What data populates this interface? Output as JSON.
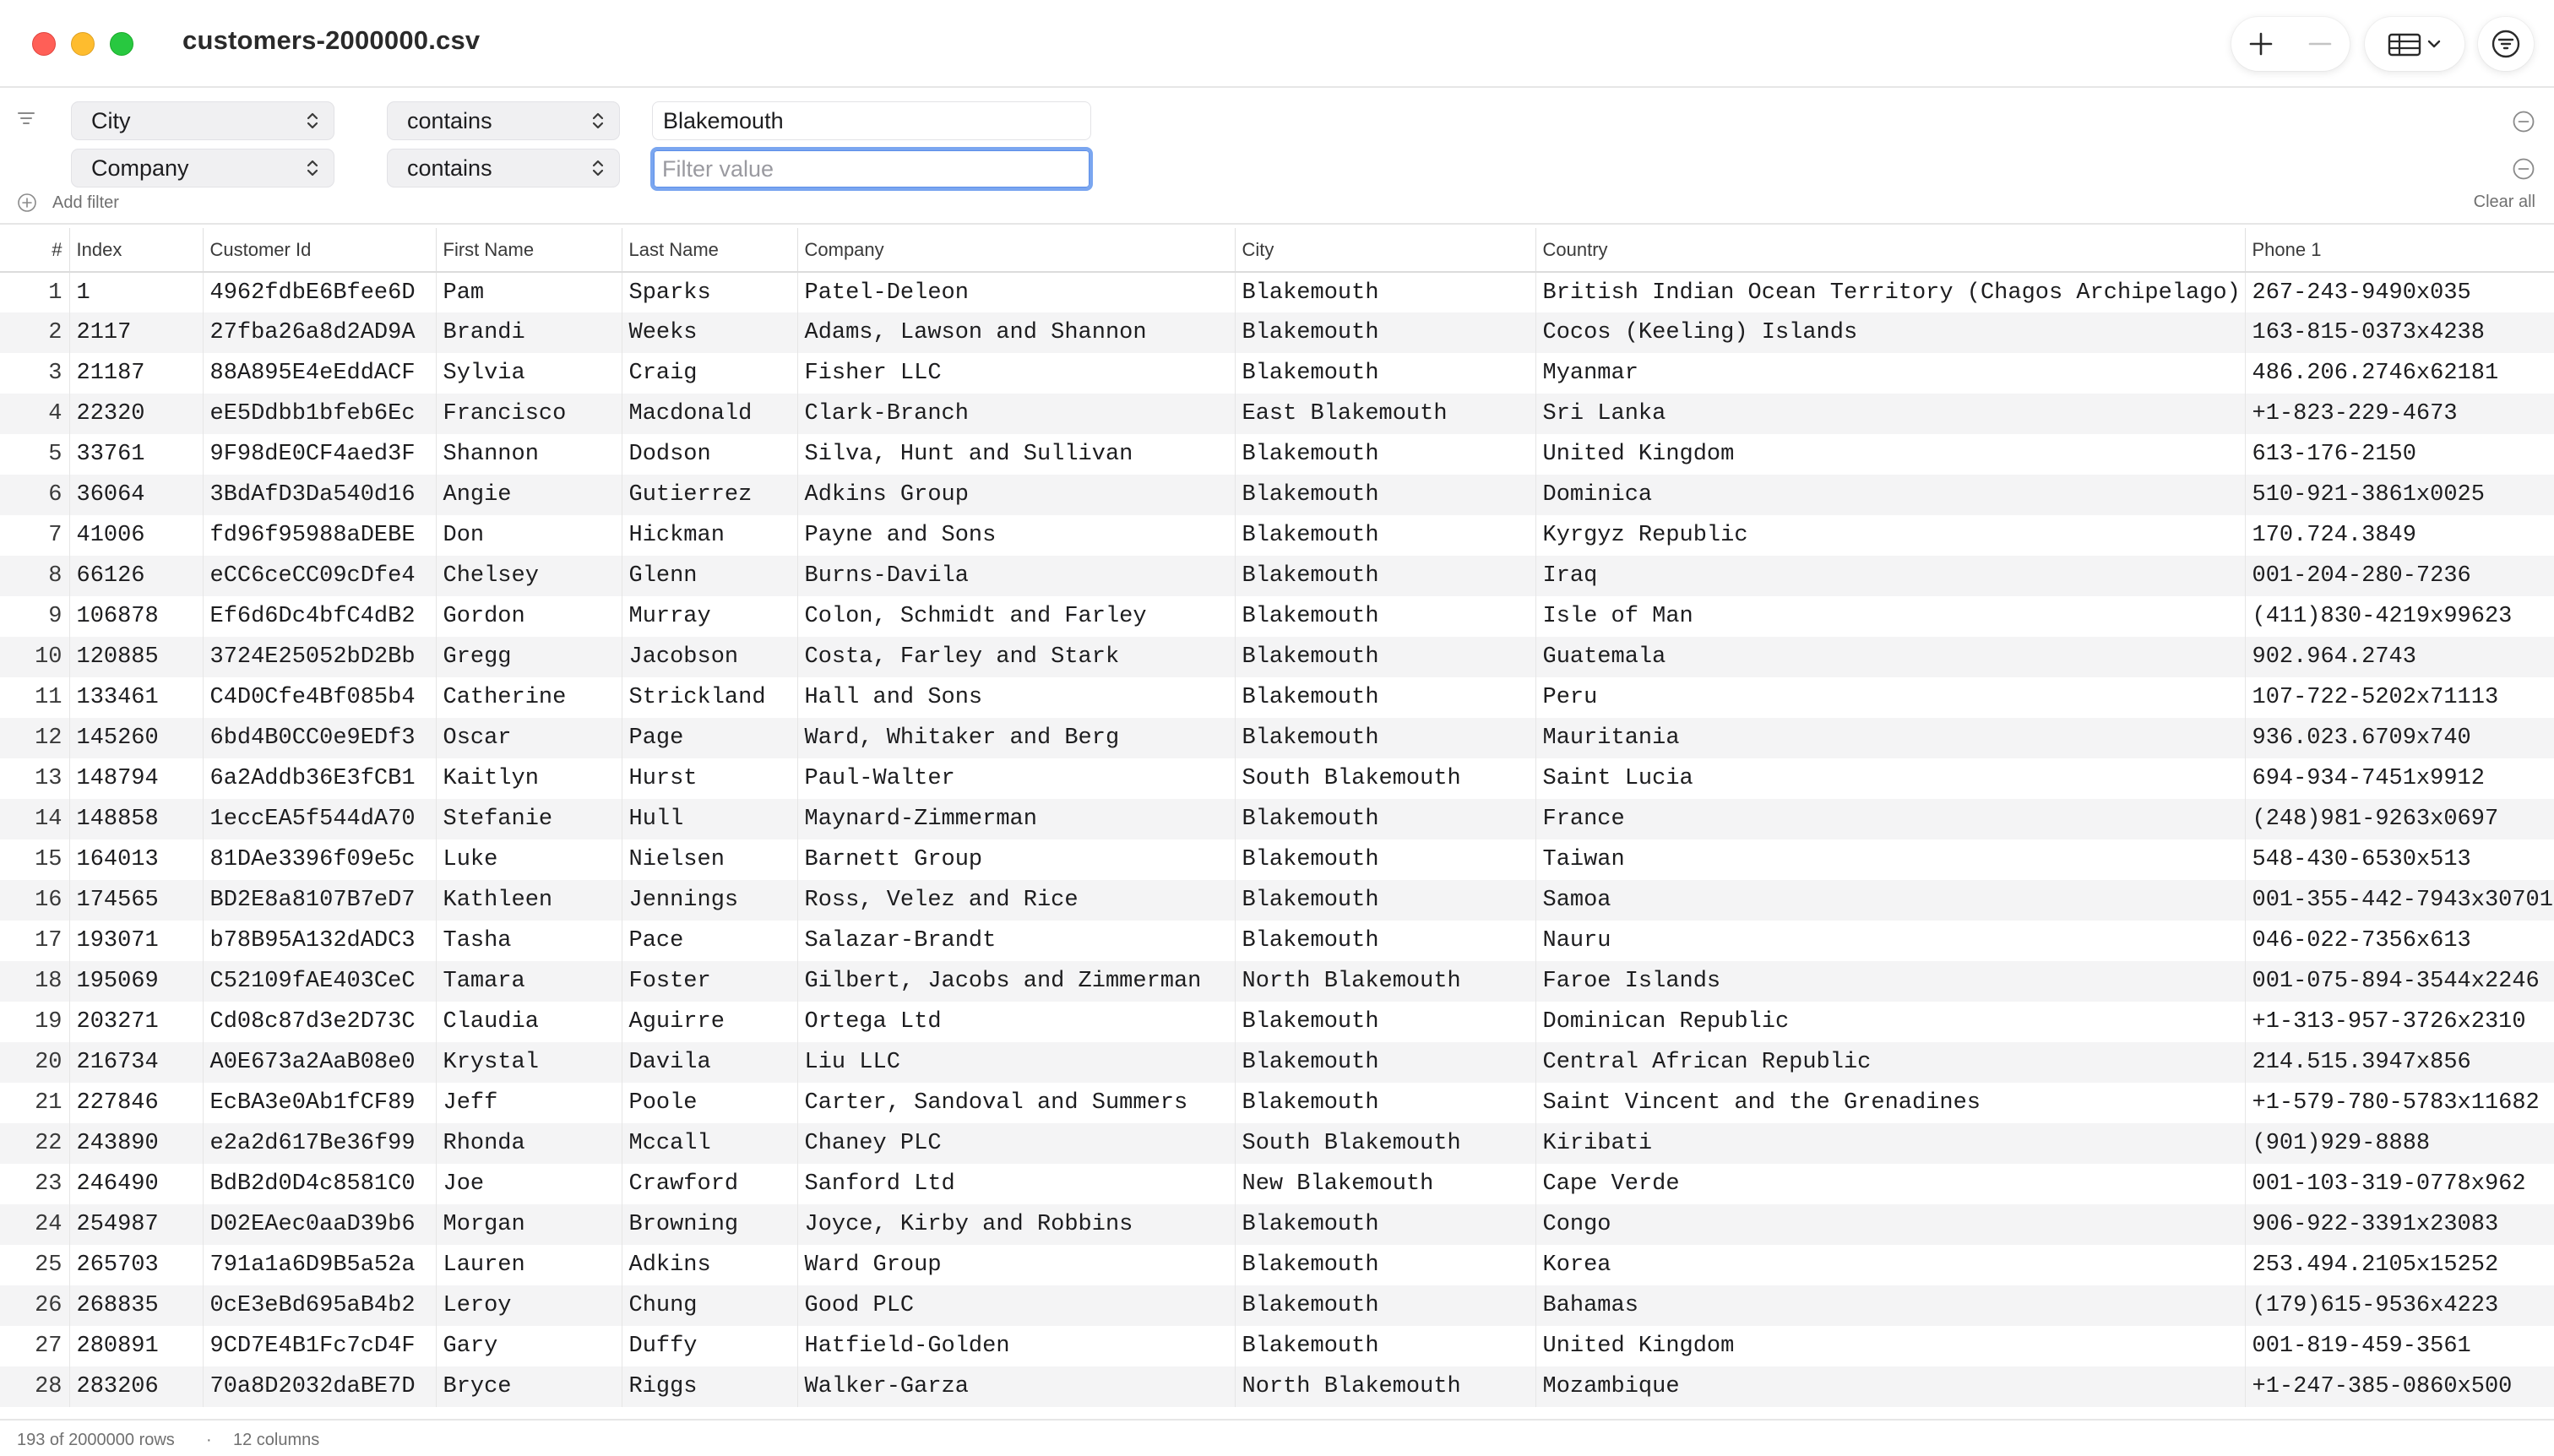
{
  "window": {
    "title": "customers-2000000.csv",
    "traffic_colors": {
      "close": "#ff5f57",
      "minimize": "#febc2e",
      "maximize": "#28c840"
    }
  },
  "toolbar": {
    "icons": [
      "plus-icon",
      "minus-icon",
      "table-view-icon",
      "chevron-down-icon",
      "filter-icon"
    ]
  },
  "filters": {
    "rows": [
      {
        "field": "City",
        "operator": "contains",
        "value": "Blakemouth",
        "placeholder": "Filter value"
      },
      {
        "field": "Company",
        "operator": "contains",
        "value": "",
        "placeholder": "Filter value"
      }
    ],
    "add_filter_label": "Add filter",
    "clear_all_label": "Clear all",
    "focus_color": "#7aa6f0"
  },
  "table": {
    "columns": [
      "#",
      "Index",
      "Customer Id",
      "First Name",
      "Last Name",
      "Company",
      "City",
      "Country",
      "Phone 1"
    ],
    "rows": [
      [
        "1",
        "1",
        "4962fdbE6Bfee6D",
        "Pam",
        "Sparks",
        "Patel-Deleon",
        "Blakemouth",
        "British Indian Ocean Territory (Chagos Archipelago)",
        "267-243-9490x035"
      ],
      [
        "2",
        "2117",
        "27fba26a8d2AD9A",
        "Brandi",
        "Weeks",
        "Adams, Lawson and Shannon",
        "Blakemouth",
        "Cocos (Keeling) Islands",
        "163-815-0373x4238"
      ],
      [
        "3",
        "21187",
        "88A895E4eEddACF",
        "Sylvia",
        "Craig",
        "Fisher LLC",
        "Blakemouth",
        "Myanmar",
        "486.206.2746x62181"
      ],
      [
        "4",
        "22320",
        "eE5Ddbb1bfeb6Ec",
        "Francisco",
        "Macdonald",
        "Clark-Branch",
        "East Blakemouth",
        "Sri Lanka",
        "+1-823-229-4673"
      ],
      [
        "5",
        "33761",
        "9F98dE0CF4aed3F",
        "Shannon",
        "Dodson",
        "Silva, Hunt and Sullivan",
        "Blakemouth",
        "United Kingdom",
        "613-176-2150"
      ],
      [
        "6",
        "36064",
        "3BdAfD3Da540d16",
        "Angie",
        "Gutierrez",
        "Adkins Group",
        "Blakemouth",
        "Dominica",
        "510-921-3861x0025"
      ],
      [
        "7",
        "41006",
        "fd96f95988aDEBE",
        "Don",
        "Hickman",
        "Payne and Sons",
        "Blakemouth",
        "Kyrgyz Republic",
        "170.724.3849"
      ],
      [
        "8",
        "66126",
        "eCC6ceCC09cDfe4",
        "Chelsey",
        "Glenn",
        "Burns-Davila",
        "Blakemouth",
        "Iraq",
        "001-204-280-7236"
      ],
      [
        "9",
        "106878",
        "Ef6d6Dc4bfC4dB2",
        "Gordon",
        "Murray",
        "Colon, Schmidt and Farley",
        "Blakemouth",
        "Isle of Man",
        "(411)830-4219x99623"
      ],
      [
        "10",
        "120885",
        "3724E25052bD2Bb",
        "Gregg",
        "Jacobson",
        "Costa, Farley and Stark",
        "Blakemouth",
        "Guatemala",
        "902.964.2743"
      ],
      [
        "11",
        "133461",
        "C4D0Cfe4Bf085b4",
        "Catherine",
        "Strickland",
        "Hall and Sons",
        "Blakemouth",
        "Peru",
        "107-722-5202x71113"
      ],
      [
        "12",
        "145260",
        "6bd4B0CC0e9EDf3",
        "Oscar",
        "Page",
        "Ward, Whitaker and Berg",
        "Blakemouth",
        "Mauritania",
        "936.023.6709x740"
      ],
      [
        "13",
        "148794",
        "6a2Addb36E3fCB1",
        "Kaitlyn",
        "Hurst",
        "Paul-Walter",
        "South Blakemouth",
        "Saint Lucia",
        "694-934-7451x9912"
      ],
      [
        "14",
        "148858",
        "1eccEA5f544dA70",
        "Stefanie",
        "Hull",
        "Maynard-Zimmerman",
        "Blakemouth",
        "France",
        "(248)981-9263x0697"
      ],
      [
        "15",
        "164013",
        "81DAe3396f09e5c",
        "Luke",
        "Nielsen",
        "Barnett Group",
        "Blakemouth",
        "Taiwan",
        "548-430-6530x513"
      ],
      [
        "16",
        "174565",
        "BD2E8a8107B7eD7",
        "Kathleen",
        "Jennings",
        "Ross, Velez and Rice",
        "Blakemouth",
        "Samoa",
        "001-355-442-7943x30701"
      ],
      [
        "17",
        "193071",
        "b78B95A132dADC3",
        "Tasha",
        "Pace",
        "Salazar-Brandt",
        "Blakemouth",
        "Nauru",
        "046-022-7356x613"
      ],
      [
        "18",
        "195069",
        "C52109fAE403CeC",
        "Tamara",
        "Foster",
        "Gilbert, Jacobs and Zimmerman",
        "North Blakemouth",
        "Faroe Islands",
        "001-075-894-3544x2246"
      ],
      [
        "19",
        "203271",
        "Cd08c87d3e2D73C",
        "Claudia",
        "Aguirre",
        "Ortega Ltd",
        "Blakemouth",
        "Dominican Republic",
        "+1-313-957-3726x2310"
      ],
      [
        "20",
        "216734",
        "A0E673a2AaB08e0",
        "Krystal",
        "Davila",
        "Liu LLC",
        "Blakemouth",
        "Central African Republic",
        "214.515.3947x856"
      ],
      [
        "21",
        "227846",
        "EcBA3e0Ab1fCF89",
        "Jeff",
        "Poole",
        "Carter, Sandoval and Summers",
        "Blakemouth",
        "Saint Vincent and the Grenadines",
        "+1-579-780-5783x11682"
      ],
      [
        "22",
        "243890",
        "e2a2d617Be36f99",
        "Rhonda",
        "Mccall",
        "Chaney PLC",
        "South Blakemouth",
        "Kiribati",
        "(901)929-8888"
      ],
      [
        "23",
        "246490",
        "BdB2d0D4c8581C0",
        "Joe",
        "Crawford",
        "Sanford Ltd",
        "New Blakemouth",
        "Cape Verde",
        "001-103-319-0778x962"
      ],
      [
        "24",
        "254987",
        "D02EAec0aaD39b6",
        "Morgan",
        "Browning",
        "Joyce, Kirby and Robbins",
        "Blakemouth",
        "Congo",
        "906-922-3391x23083"
      ],
      [
        "25",
        "265703",
        "791a1a6D9B5a52a",
        "Lauren",
        "Adkins",
        "Ward Group",
        "Blakemouth",
        "Korea",
        "253.494.2105x15252"
      ],
      [
        "26",
        "268835",
        "0cE3eBd695aB4b2",
        "Leroy",
        "Chung",
        "Good PLC",
        "Blakemouth",
        "Bahamas",
        "(179)615-9536x4223"
      ],
      [
        "27",
        "280891",
        "9CD7E4B1Fc7cD4F",
        "Gary",
        "Duffy",
        "Hatfield-Golden",
        "Blakemouth",
        "United Kingdom",
        "001-819-459-3561"
      ],
      [
        "28",
        "283206",
        "70a8D2032daBE7D",
        "Bryce",
        "Riggs",
        "Walker-Garza",
        "North Blakemouth",
        "Mozambique",
        "+1-247-385-0860x500"
      ]
    ]
  },
  "status": {
    "rows_text": "193 of 2000000 rows",
    "separator": "·",
    "columns_text": "12 columns"
  }
}
